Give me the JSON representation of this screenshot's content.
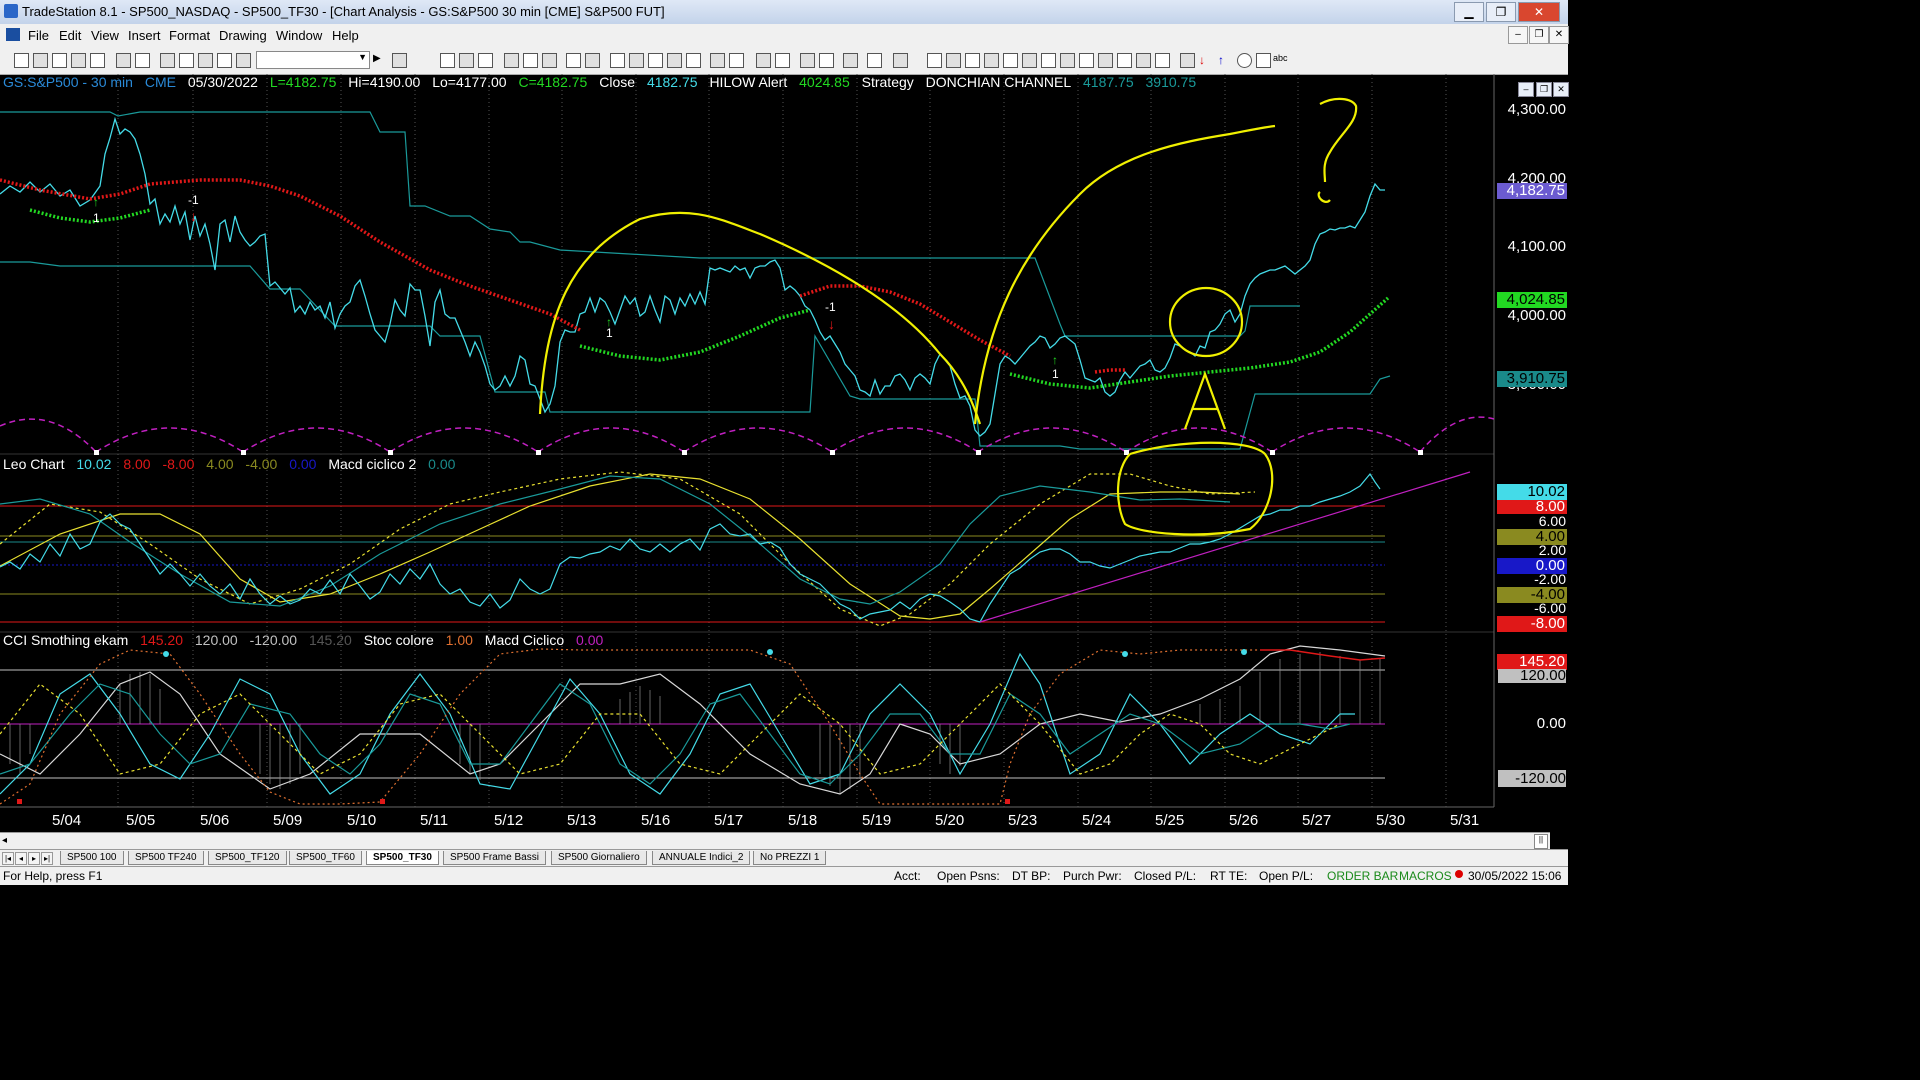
{
  "window": {
    "title": "TradeStation 8.1 - SP500_NASDAQ - SP500_TF30 - [Chart Analysis - GS:S&P500  30 min  [CME] S&P500 FUT]",
    "minimize": "▁",
    "maximize": "❐",
    "close": "✕"
  },
  "menu": {
    "items": [
      "File",
      "Edit",
      "View",
      "Insert",
      "Format",
      "Drawing",
      "Window",
      "Help"
    ]
  },
  "price_panel": {
    "symbol": "GS:S&P500 - 30 min",
    "exchange": "CME",
    "date": "05/30/2022",
    "last": "L=4182.75",
    "high": "Hi=4190.00",
    "low": "Lo=4177.00",
    "close_val": "C=4182.75",
    "close_label": "Close",
    "close_price": "4182.75",
    "hilow_label": "HILOW Alert",
    "hilow_val": "4024.85",
    "strategy_label": "Strategy",
    "donchian_label": "DONCHIAN CHANNEL",
    "donchian_upper": "4187.75",
    "donchian_lower": "3910.75",
    "axis_ticks": [
      "4,300.00",
      "4,200.00",
      "4,100.00",
      "4,000.00",
      "3,900.00"
    ],
    "boxes": {
      "last": "4,182.75",
      "hilow": "4,024.85",
      "donchian_low": "3,910.75"
    },
    "signals": [
      "1",
      "-1",
      "1",
      "-1",
      "1"
    ]
  },
  "leo_panel": {
    "title": "Leo Chart",
    "values": [
      "10.02",
      "8.00",
      "-8.00",
      "4.00",
      "-4.00",
      "0.00"
    ],
    "macd_label": "Macd ciclico 2",
    "macd_val": "0.00",
    "axis_ticks": [
      "6.00",
      "2.00",
      "-2.00",
      "-6.00"
    ],
    "boxes": [
      "10.02",
      "8.00",
      "4.00",
      "0.00",
      "-4.00",
      "-8.00"
    ]
  },
  "cci_panel": {
    "title": "CCI Smothing ekam",
    "values": [
      "145.20",
      "120.00",
      "-120.00",
      "145.20"
    ],
    "stoc_label": "Stoc colore",
    "stoc_val": "1.00",
    "macd_label": "Macd Ciclico",
    "macd_val": "0.00",
    "axis_ticks": [
      "120.00",
      "0.00",
      "-120.00"
    ],
    "box_val": "145.20"
  },
  "dates": [
    "5/04",
    "5/05",
    "5/06",
    "5/09",
    "5/10",
    "5/11",
    "5/12",
    "5/13",
    "5/16",
    "5/17",
    "5/18",
    "5/19",
    "5/20",
    "5/23",
    "5/24",
    "5/25",
    "5/26",
    "5/27",
    "5/30",
    "5/31"
  ],
  "tabs": [
    "SP500 100",
    "SP500 TF240",
    "SP500_TF120",
    "SP500_TF60",
    "SP500_TF30",
    "SP500 Frame Bassi",
    "SP500 Giornaliero",
    "ANNUALE Indici_2",
    "No PREZZI 1"
  ],
  "active_tab": "SP500_TF30",
  "status": {
    "help": "For Help, press F1",
    "acct": "Acct:",
    "open_psns": "Open Psns:",
    "dt_bp": "DT BP:",
    "purch_pwr": "Purch Pwr:",
    "closed_pl": "Closed P/L:",
    "rt_te": "RT TE:",
    "open_pl": "Open P/L:",
    "order_bar": "ORDER BAR",
    "macros": "MACROS",
    "datetime": "30/05/2022 15:06"
  },
  "colors": {
    "cyan": "#2fd0e0",
    "red": "#e01818",
    "green": "#22d822",
    "yellow": "#f0f000",
    "teal": "#1a8a8a",
    "magenta": "#c020c0",
    "purple_box": "#6b5bd0"
  }
}
